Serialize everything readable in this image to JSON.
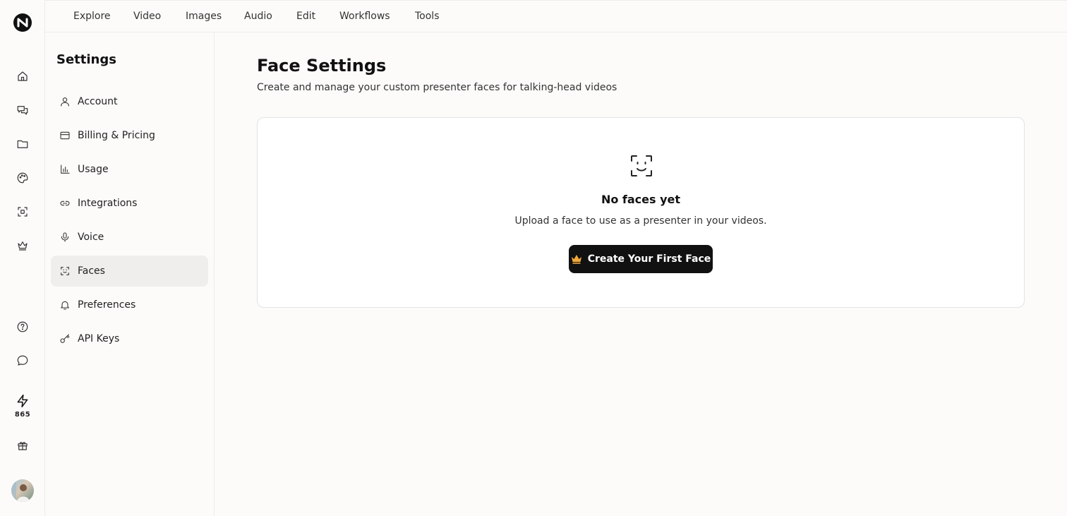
{
  "app": {
    "logo_icon": "brand-logo-icon"
  },
  "rail": {
    "icons": [
      "home-icon",
      "chat-icon",
      "folder-icon",
      "palette-icon",
      "scan-icon",
      "crown-icon"
    ],
    "bottom_icons": [
      "help-icon",
      "message-icon",
      "gift-icon"
    ],
    "credits": "865"
  },
  "topnav": {
    "items": [
      "Explore",
      "Video",
      "Images",
      "Audio",
      "Edit",
      "Workflows",
      "Tools"
    ]
  },
  "sidebar": {
    "title": "Settings",
    "items": [
      {
        "label": "Account",
        "icon": "user-icon"
      },
      {
        "label": "Billing & Pricing",
        "icon": "credit-card-icon"
      },
      {
        "label": "Usage",
        "icon": "bar-chart-icon"
      },
      {
        "label": "Integrations",
        "icon": "link-icon"
      },
      {
        "label": "Voice",
        "icon": "microphone-icon"
      },
      {
        "label": "Faces",
        "icon": "face-scan-icon",
        "active": true
      },
      {
        "label": "Preferences",
        "icon": "bell-icon"
      },
      {
        "label": "API Keys",
        "icon": "key-icon"
      }
    ]
  },
  "main": {
    "title": "Face Settings",
    "subtitle": "Create and manage your custom presenter faces for talking-head videos",
    "empty": {
      "title": "No faces yet",
      "subtitle": "Upload a face to use as a presenter in your videos.",
      "cta_label": "Create Your First Face"
    }
  },
  "colors": {
    "accent": "#111111",
    "crown": "#f2a93b",
    "active_bg": "#efeeec"
  }
}
